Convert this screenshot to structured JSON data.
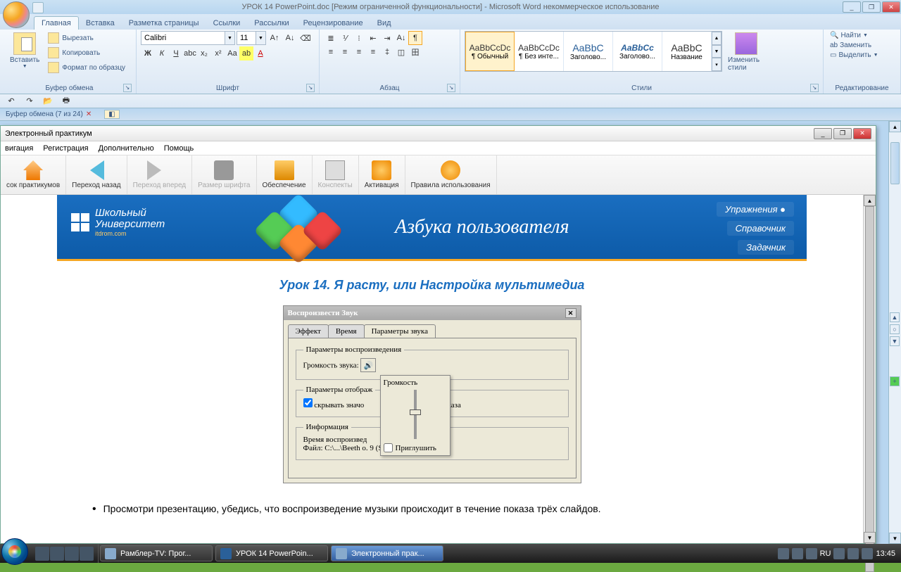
{
  "word": {
    "title": "УРОК 14 PowerPoint.doc [Режим ограниченной функциональности] - Microsoft Word некоммерческое использование",
    "tabs": [
      "Главная",
      "Вставка",
      "Разметка страницы",
      "Ссылки",
      "Рассылки",
      "Рецензирование",
      "Вид"
    ],
    "clipboard": {
      "label": "Буфер обмена",
      "paste": "Вставить",
      "cut": "Вырезать",
      "copy": "Копировать",
      "format_painter": "Формат по образцу"
    },
    "font": {
      "label": "Шрифт",
      "name": "Calibri",
      "size": "11"
    },
    "paragraph": {
      "label": "Абзац"
    },
    "styles": {
      "label": "Стили",
      "items": [
        {
          "preview": "AaBbCcDc",
          "name": "¶ Обычный"
        },
        {
          "preview": "AaBbCcDc",
          "name": "¶ Без инте..."
        },
        {
          "preview": "AaBbC",
          "name": "Заголово..."
        },
        {
          "preview": "AaBbCc",
          "name": "Заголово..."
        },
        {
          "preview": "AaBbC",
          "name": "Название"
        }
      ],
      "change": "Изменить стили"
    },
    "editing": {
      "label": "Редактирование",
      "find": "Найти",
      "replace": "Заменить",
      "select": "Выделить"
    },
    "clipboard_pane": "Буфер обмена (7 из 24)"
  },
  "prac": {
    "title": "Электронный практикум",
    "menu": [
      "вигация",
      "Регистрация",
      "Дополнительно",
      "Помощь"
    ],
    "toolbar": [
      {
        "label": "сок практикумов"
      },
      {
        "label": "Переход назад"
      },
      {
        "label": "Переход вперед"
      },
      {
        "label": "Размер шрифта"
      },
      {
        "label": "Обеспечение"
      },
      {
        "label": "Конспекты"
      },
      {
        "label": "Активация"
      },
      {
        "label": "Правила использования"
      }
    ],
    "logo": {
      "l1": "Школьный",
      "l2": "Университет",
      "sub": "itdrom.com"
    },
    "headline": "Азбука пользователя",
    "rnav": [
      "Упражнения  ●",
      "Справочник",
      "Задачник"
    ],
    "lesson": "Урок 14. Я расту, или Настройка мультимедиа",
    "dialog": {
      "title": "Воспроизвести Звук",
      "tabs": [
        "Эффект",
        "Время",
        "Параметры звука"
      ],
      "g1": "Параметры воспроизведения",
      "vol_label": "Громкость звука:",
      "g2": "Параметры отображ",
      "chk": "скрывать значо",
      "chk_tail": "оказа",
      "g3": "Информация",
      "time": "Время воспроизвед",
      "file_l": "Файл:",
      "file_v": "C:\\...\\Beeth                            o. 9 (Scherzo).wma",
      "popup": {
        "title": "Громкость",
        "mute": "Приглушить"
      }
    },
    "bullet": "Просмотри презентацию, убедись, что воспроизведение музыки происходит в течение показа трёх слайдов."
  },
  "taskbar": {
    "buttons": [
      {
        "label": "Рамблер-TV: Прог..."
      },
      {
        "label": "УРОК 14 PowerPoin..."
      },
      {
        "label": "Электронный прак..."
      }
    ],
    "lang": "RU",
    "time": "13:45"
  }
}
